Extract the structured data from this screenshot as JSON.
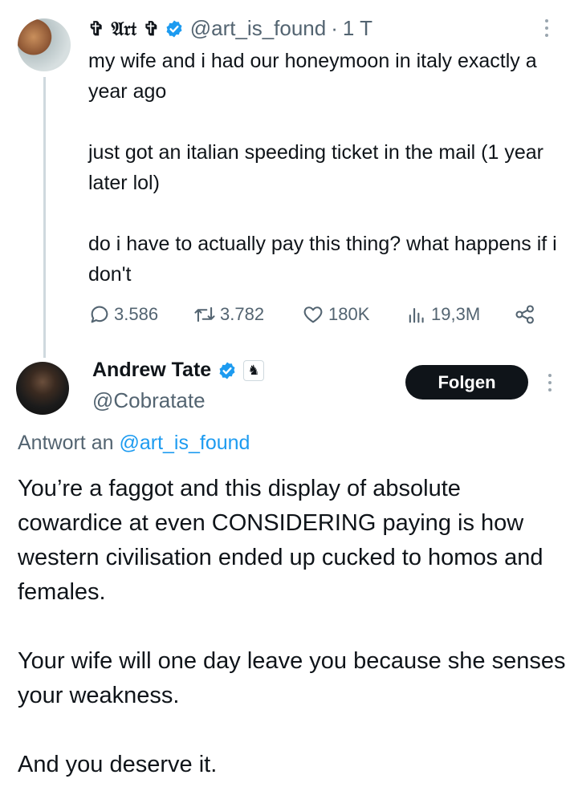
{
  "original_tweet": {
    "display_name": "✞ 𝔄𝔯𝔱 ✞",
    "handle": "@art_is_found",
    "separator": "·",
    "time": "1 T",
    "paragraphs": [
      "my wife and i had our honeymoon in italy exactly a year ago",
      "just got an italian speeding ticket in the mail (1 year later lol)",
      "do i have to actually pay this thing? what happens if i don't"
    ],
    "stats": {
      "replies": "3.586",
      "retweets": "3.782",
      "likes": "180K",
      "views": "19,3M"
    },
    "icons": {
      "reply": "comment-icon",
      "retweet": "retweet-icon",
      "like": "heart-icon",
      "views": "views-chart-icon",
      "share": "share-icon",
      "more": "more-dots-icon",
      "verified": "verified-badge-icon"
    }
  },
  "reply_tweet": {
    "display_name": "Andrew Tate",
    "handle": "@Cobratate",
    "follow_label": "Folgen",
    "reply_prefix": "Antwort an",
    "reply_target": "@art_is_found",
    "paragraphs": [
      "You’re a faggot and this display of absolute cowardice at even CONSIDERING paying is how western civilisation ended up cucked to homos and females.",
      "Your wife will one day leave you because she senses your weakness.",
      "And you deserve it."
    ],
    "icons": {
      "verified": "verified-badge-icon",
      "affiliate": "chess-knight-badge-icon",
      "more": "more-dots-icon"
    }
  },
  "colors": {
    "text": "#0f1419",
    "secondary": "#536471",
    "verified_blue": "#1d9bf0",
    "link": "#1d9bf0",
    "follow_button_bg": "#0f1419",
    "thread_line": "#cfd9de"
  }
}
